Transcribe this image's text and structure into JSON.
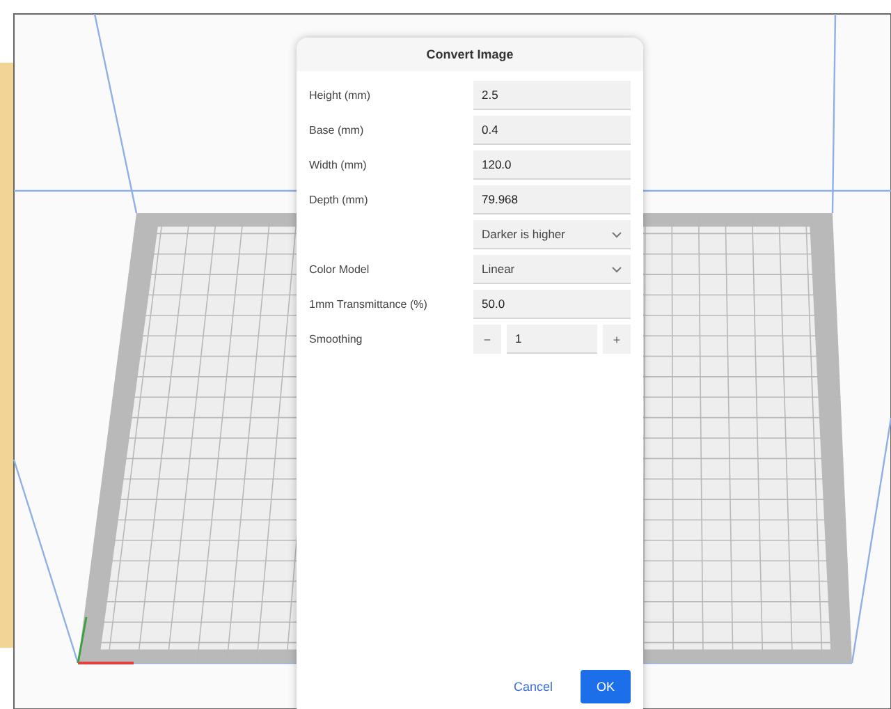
{
  "dialog": {
    "title": "Convert Image",
    "fields": [
      {
        "kind": "text",
        "label": "Height (mm)",
        "value": "2.5"
      },
      {
        "kind": "text",
        "label": "Base (mm)",
        "value": "0.4"
      },
      {
        "kind": "text",
        "label": "Width (mm)",
        "value": "120.0"
      },
      {
        "kind": "text",
        "label": "Depth (mm)",
        "value": "79.968"
      },
      {
        "kind": "select",
        "value": "Darker is higher"
      },
      {
        "kind": "select",
        "label": "Color Model",
        "value": "Linear"
      },
      {
        "kind": "text",
        "label": "1mm Transmittance (%)",
        "value": "50.0"
      },
      {
        "kind": "spin",
        "label": "Smoothing",
        "value": "1",
        "minus": "−",
        "plus": "+"
      }
    ],
    "buttons": [
      {
        "kind": "secondary",
        "label": "Cancel"
      },
      {
        "kind": "primary",
        "label": "OK"
      }
    ]
  }
}
